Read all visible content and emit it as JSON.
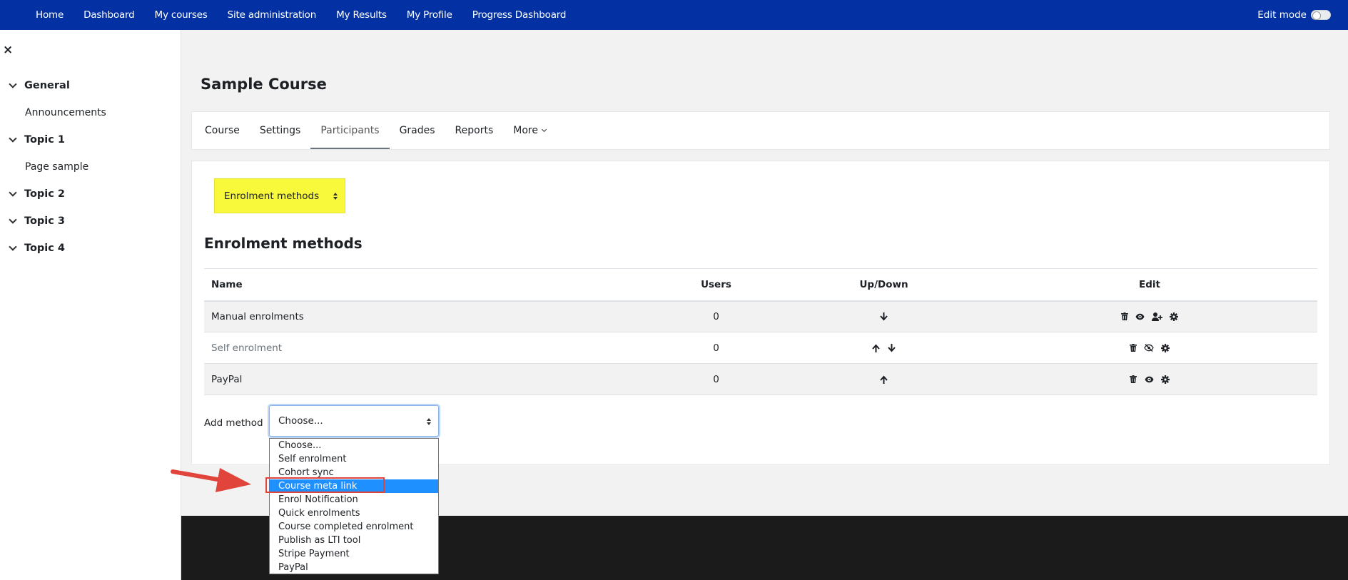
{
  "navbar": {
    "items": [
      "Home",
      "Dashboard",
      "My courses",
      "Site administration",
      "My Results",
      "My Profile",
      "Progress Dashboard"
    ],
    "edit_mode_label": "Edit mode"
  },
  "drawer": {
    "close_glyph": "×",
    "sections": [
      {
        "label": "General",
        "links": [
          "Announcements"
        ]
      },
      {
        "label": "Topic 1",
        "links": [
          "Page sample"
        ]
      },
      {
        "label": "Topic 2",
        "links": []
      },
      {
        "label": "Topic 3",
        "links": []
      },
      {
        "label": "Topic 4",
        "links": []
      }
    ]
  },
  "course": {
    "title": "Sample Course",
    "tabs": [
      "Course",
      "Settings",
      "Participants",
      "Grades",
      "Reports",
      "More"
    ],
    "active_tab": "Participants"
  },
  "page": {
    "jump_select_value": "Enrolment methods",
    "heading": "Enrolment methods",
    "table": {
      "headers": {
        "name": "Name",
        "users": "Users",
        "updown": "Up/Down",
        "edit": "Edit"
      },
      "rows": [
        {
          "name": "Manual enrolments",
          "users": "0",
          "up": false,
          "down": true,
          "edit_icons": [
            "trash-icon",
            "eye-icon",
            "user-plus-icon",
            "gear-icon"
          ]
        },
        {
          "name": "Self enrolment",
          "users": "0",
          "up": true,
          "down": true,
          "edit_icons": [
            "trash-icon",
            "eye-slash-icon",
            "gear-icon"
          ],
          "disabled": true
        },
        {
          "name": "PayPal",
          "users": "0",
          "up": true,
          "down": false,
          "edit_icons": [
            "trash-icon",
            "eye-icon",
            "gear-icon"
          ]
        }
      ]
    },
    "add_method": {
      "label": "Add method",
      "value": "Choose...",
      "options": [
        "Choose...",
        "Self enrolment",
        "Cohort sync",
        "Course meta link",
        "Enrol Notification",
        "Quick enrolments",
        "Course completed enrolment",
        "Publish as LTI tool",
        "Stripe Payment",
        "PayPal"
      ],
      "highlighted": "Course meta link"
    }
  },
  "colors": {
    "navbar": "#0331a3",
    "highlight_yellow": "#f9f93c",
    "annotation_red": "#e0443a",
    "dropdown_selected": "#1e90ff"
  }
}
